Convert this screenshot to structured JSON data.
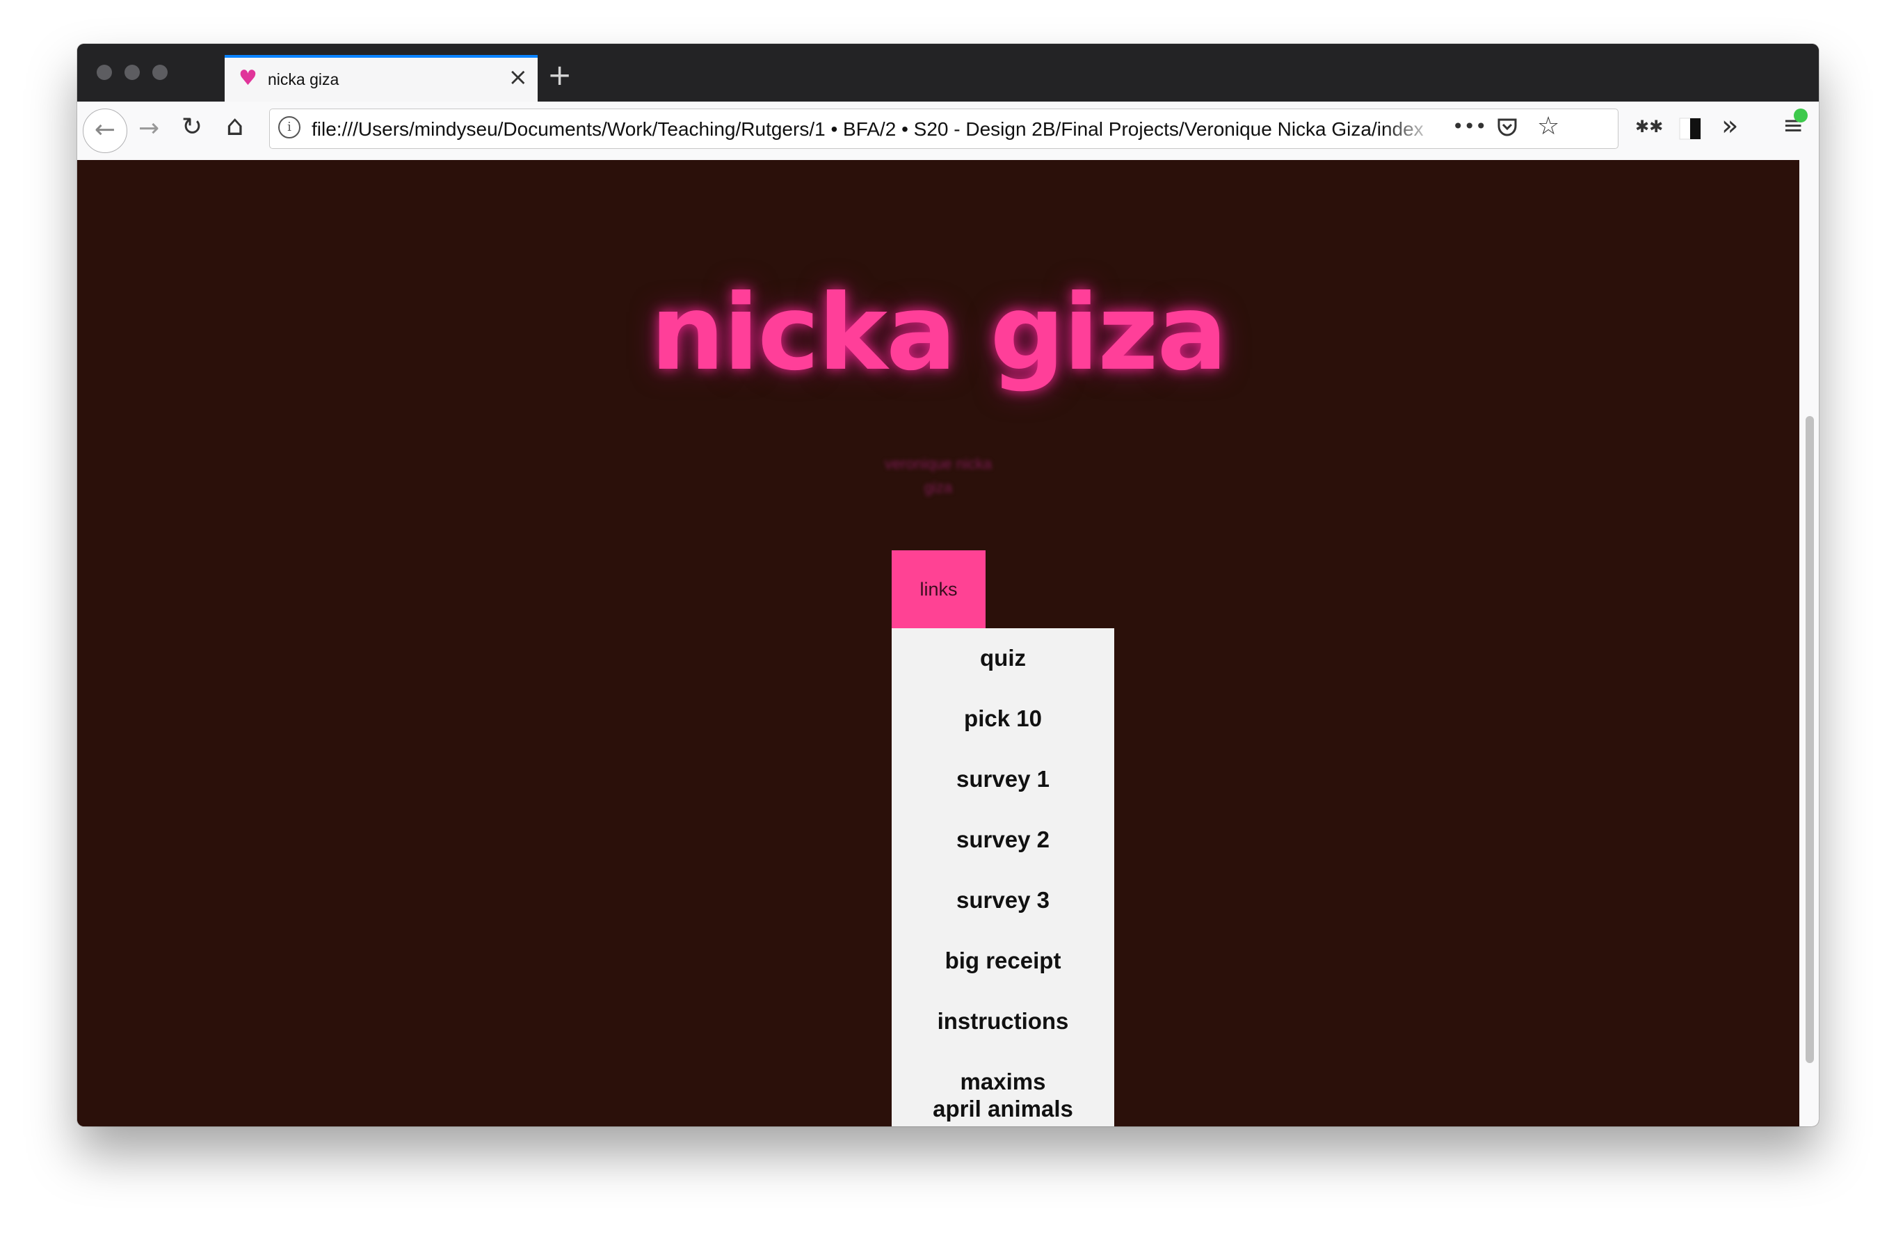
{
  "browser": {
    "tab_title": "nicka giza",
    "tab_icon": "heart-icon",
    "new_tab_label": "+",
    "close_label": "×",
    "url": "file:///Users/mindyseu/Documents/Work/Teaching/Rutgers/1 • BFA/2 • S20 - Design 2B/Final Projects/Veronique Nicka Giza/index",
    "url_menu_label": "•••",
    "icons": {
      "back": "←",
      "forward": "→",
      "reload": "↻",
      "home": "⌂",
      "info": "i",
      "pocket": "pocket-icon",
      "bookmark": "☆",
      "extension": "✱✱",
      "sidebar": "sidebar-icon",
      "overflow": "»",
      "menu": "≡"
    }
  },
  "page": {
    "title": "nicka giza",
    "subtitle_lines": [
      "veronique nicka",
      "giza"
    ],
    "links_label": "links",
    "menu_items": [
      "quiz",
      "pick 10",
      "survey 1",
      "survey 2",
      "survey 3",
      "big receipt",
      "instructions",
      "maxims",
      "april animals"
    ]
  },
  "colors": {
    "page_background": "#2b100a",
    "accent_pink": "#ff3f99",
    "links_button": "#ff4294",
    "dropdown_background": "#f2f2f2",
    "chrome_dark": "#232325",
    "active_tab_indicator": "#0a84ff"
  }
}
